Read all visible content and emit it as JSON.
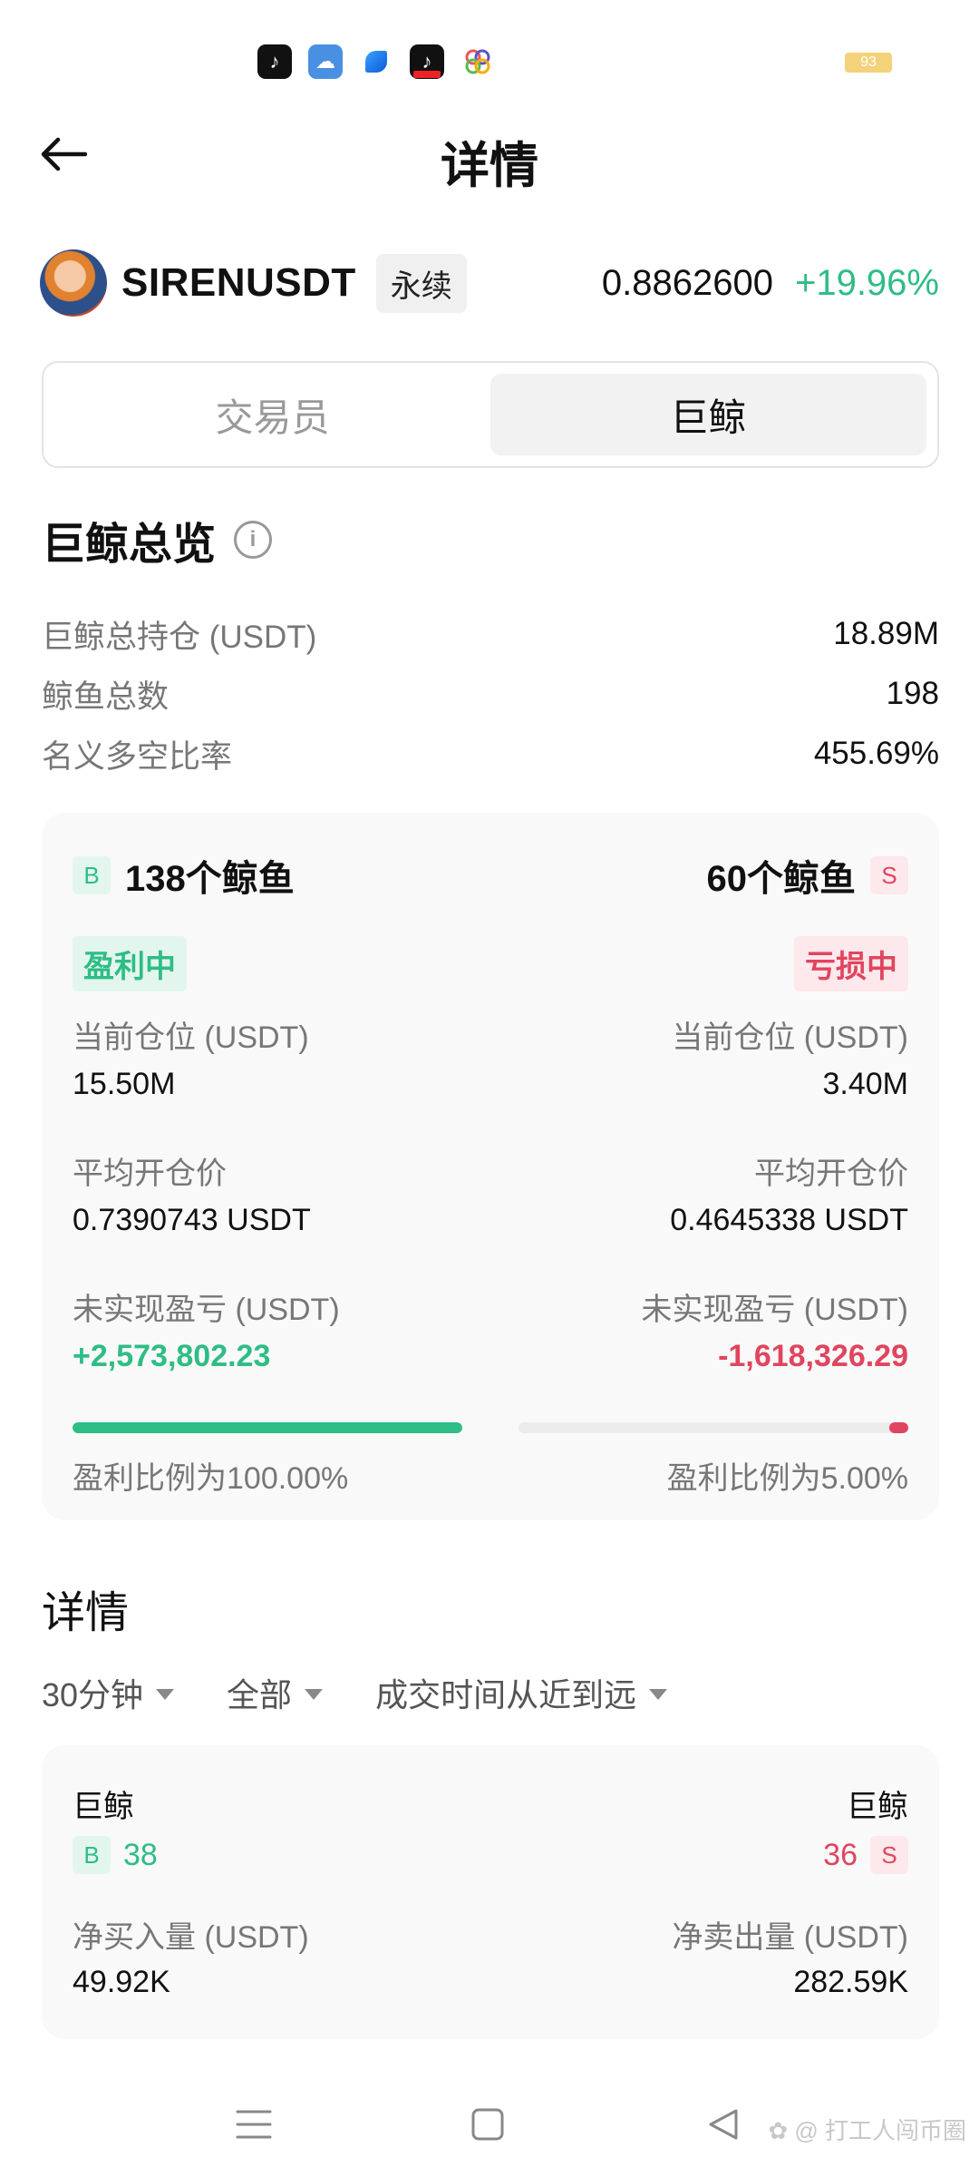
{
  "header": {
    "title": "详情",
    "back_icon": "arrow-left-icon"
  },
  "status_bar": {
    "battery": "93"
  },
  "symbol": {
    "name": "SIRENUSDT",
    "type_tag": "永续",
    "price": "0.8862600",
    "change": "+19.96%",
    "change_color": "#2ebd85"
  },
  "tabs": [
    {
      "label": "交易员",
      "active": false
    },
    {
      "label": "巨鲸",
      "active": true
    }
  ],
  "overview": {
    "title": "巨鲸总览",
    "rows": [
      {
        "label": "巨鲸总持仓 (USDT)",
        "value": "18.89M"
      },
      {
        "label": "鲸鱼总数",
        "value": "198"
      },
      {
        "label": "名义多空比率",
        "value": "455.69%"
      }
    ]
  },
  "long_side": {
    "badge": "B",
    "count": "138个鲸鱼",
    "status": "盈利中",
    "position_label": "当前仓位 (USDT)",
    "position_value": "15.50M",
    "avg_price_label": "平均开仓价",
    "avg_price_value": "0.7390743 USDT",
    "pnl_label": "未实现盈亏 (USDT)",
    "pnl_value": "+2,573,802.23",
    "profit_ratio_text": "盈利比例为100.00%",
    "profit_ratio": 1.0,
    "color": "#2ebd85"
  },
  "short_side": {
    "badge": "S",
    "count": "60个鲸鱼",
    "status": "亏损中",
    "position_label": "当前仓位 (USDT)",
    "position_value": "3.40M",
    "avg_price_label": "平均开仓价",
    "avg_price_value": "0.4645338 USDT",
    "pnl_label": "未实现盈亏 (USDT)",
    "pnl_value": "-1,618,326.29",
    "profit_ratio_text": "盈利比例为5.00%",
    "profit_ratio": 0.05,
    "color": "#e0455f"
  },
  "details": {
    "title": "详情",
    "filters": [
      "30分钟",
      "全部",
      "成交时间从近到远"
    ],
    "card": {
      "left_title": "巨鲸",
      "left_badge": "B",
      "left_count": "38",
      "right_title": "巨鲸",
      "right_badge": "S",
      "right_count": "36",
      "left_label": "净买入量 (USDT)",
      "left_value": "49.92K",
      "right_label": "净卖出量 (USDT)",
      "right_value": "282.59K"
    }
  },
  "nav": {
    "menu_icon": "menu-icon",
    "home_icon": "home-square-icon",
    "back_icon": "back-triangle-icon"
  },
  "watermark": "打工人闯币圈"
}
